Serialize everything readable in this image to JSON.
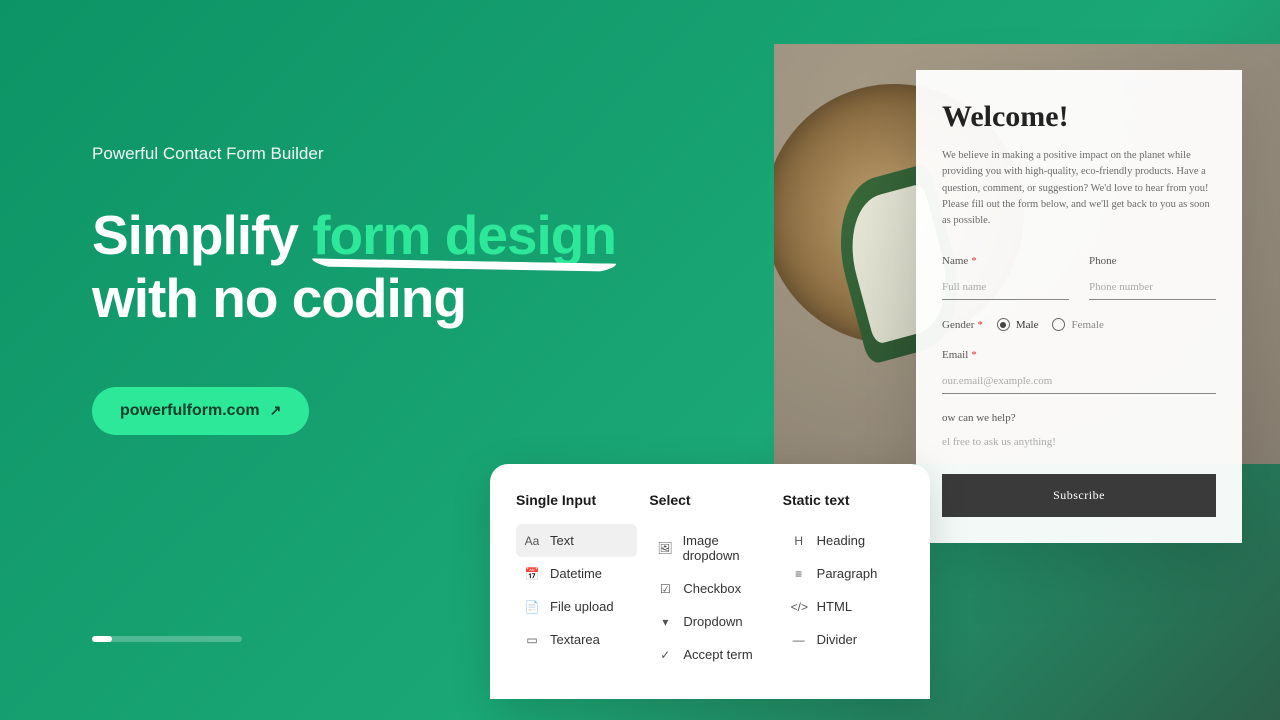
{
  "hero": {
    "eyebrow": "Powerful Contact Form Builder",
    "headline_part1": "Simplify ",
    "headline_accent": "form design",
    "headline_part2": "with no coding",
    "cta_label": "powerfulform.com",
    "cta_icon": "↗"
  },
  "panel": {
    "columns": [
      {
        "title": "Single Input",
        "items": [
          {
            "icon": "Aa",
            "label": "Text",
            "active": true
          },
          {
            "icon": "📅",
            "label": "Datetime"
          },
          {
            "icon": "📄",
            "label": "File upload"
          },
          {
            "icon": "▭",
            "label": "Textarea"
          }
        ]
      },
      {
        "title": "Select",
        "items": [
          {
            "icon": "🖼",
            "label": "Image dropdown"
          },
          {
            "icon": "☑",
            "label": "Checkbox"
          },
          {
            "icon": "▾",
            "label": "Dropdown"
          },
          {
            "icon": "✓",
            "label": "Accept term"
          }
        ]
      },
      {
        "title": "Static text",
        "items": [
          {
            "icon": "H",
            "label": "Heading"
          },
          {
            "icon": "≡",
            "label": "Paragraph"
          },
          {
            "icon": "</>",
            "label": "HTML"
          },
          {
            "icon": "—",
            "label": "Divider"
          }
        ]
      }
    ]
  },
  "preview": {
    "title": "Welcome!",
    "body": "We believe in making a positive impact on the planet while providing you with high-quality, eco-friendly products. Have a question, comment, or suggestion? We'd love to hear from you! Please fill out the form below, and we'll get back to you as soon as possible.",
    "name_label": "Name",
    "name_placeholder": "Full name",
    "phone_label": "Phone",
    "phone_placeholder": "Phone number",
    "gender_label": "Gender",
    "gender_male": "Male",
    "gender_female": "Female",
    "email_label": "Email",
    "email_placeholder": "our.email@example.com",
    "help_label": "ow can we help?",
    "help_placeholder": "el free to ask us anything!",
    "submit": "Subscribe"
  }
}
